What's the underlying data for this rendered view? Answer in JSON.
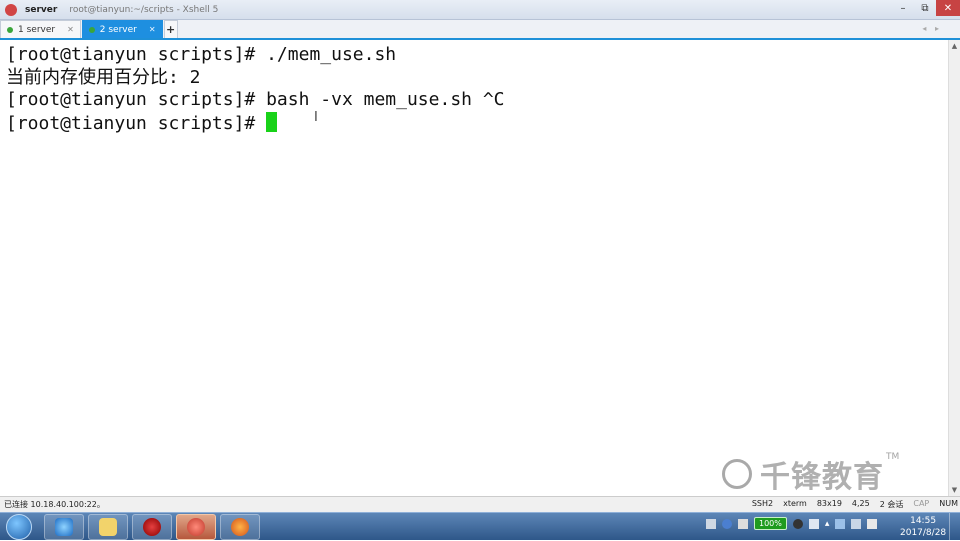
{
  "window": {
    "title": "server",
    "path": "root@tianyun:~/scripts - Xshell 5",
    "minimize": "–",
    "maximize": "⧉",
    "close": "✕"
  },
  "tabs": [
    {
      "label": "1 server",
      "close": "✕"
    },
    {
      "label": "2 server",
      "close": "✕"
    }
  ],
  "tab_add": "+",
  "tab_nav": "◂ ▸",
  "terminal": {
    "lines": [
      {
        "prompt": "[root@tianyun scripts]# ",
        "text": "./mem_use.sh"
      },
      {
        "prompt": "",
        "text": "当前内存使用百分比: 2"
      },
      {
        "prompt": "[root@tianyun scripts]# ",
        "text": "bash -vx mem_use.sh ^C"
      },
      {
        "prompt": "[root@tianyun scripts]# ",
        "text": ""
      }
    ]
  },
  "watermark": {
    "text": "千锋教育",
    "tm": "TM"
  },
  "statusbar": {
    "connection": "已连接 10.18.40.100:22。",
    "protocol": "SSH2",
    "terminal_type": "xterm",
    "size": "83x19",
    "position": "4,25",
    "sessions": "2 会话",
    "cap": "CAP",
    "num": "NUM"
  },
  "taskbar": {
    "battery": "100%",
    "time": "14:55",
    "date": "2017/8/28"
  },
  "colors": {
    "accent": "#1e8fe0",
    "cursor": "#19d219",
    "close_button": "#c74343",
    "taskbar": "#2e5789"
  }
}
